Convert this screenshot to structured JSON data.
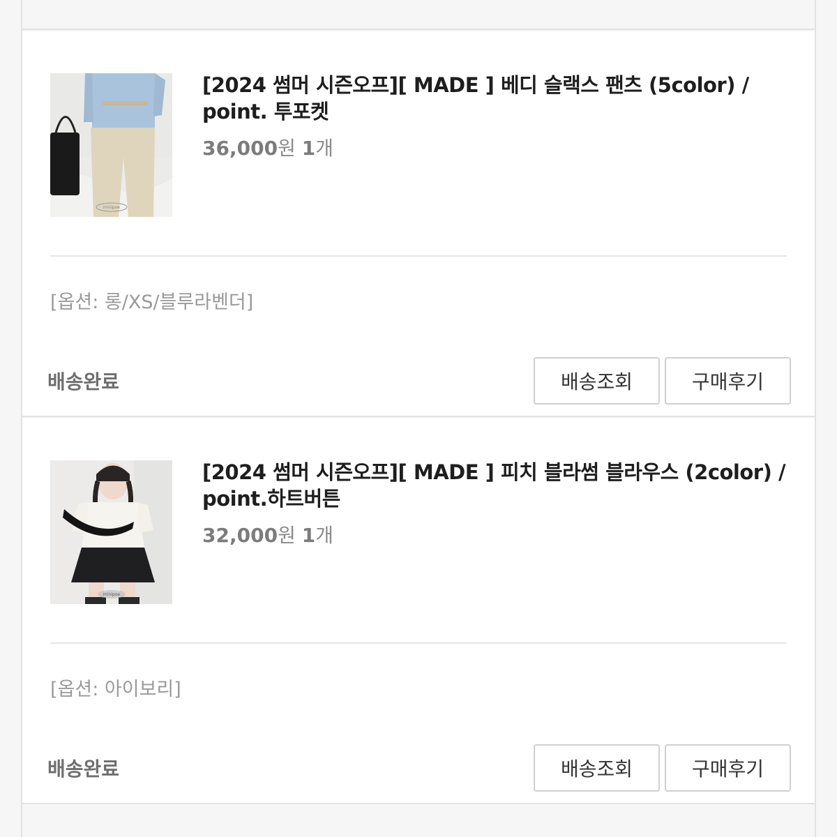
{
  "orders": [
    {
      "title": "[2024 썸머 시즌오프][ MADE ] 베디 슬랙스 팬츠 (5color) / point. 투포켓",
      "price": "36,000",
      "currency": "원",
      "quantity": "1",
      "quantity_unit": "개",
      "option": "[옵션: 롱/XS/블루라벤더]",
      "status": "배송완료",
      "track_button": "배송조회",
      "review_button": "구매후기",
      "image_label": "minipoe"
    },
    {
      "title": "[2024 썸머 시즌오프][ MADE ] 피치 블라썸 블라우스 (2color) / point.하트버튼",
      "price": "32,000",
      "currency": "원",
      "quantity": "1",
      "quantity_unit": "개",
      "option": "[옵션: 아이보리]",
      "status": "배송완료",
      "track_button": "배송조회",
      "review_button": "구매후기",
      "image_label": "minipoe"
    }
  ],
  "colors": {
    "background": "#f6f6f6",
    "card": "#ffffff",
    "border": "#e2e2e2",
    "title_text": "#1e1e1e",
    "muted_text": "#8a8a8a"
  }
}
